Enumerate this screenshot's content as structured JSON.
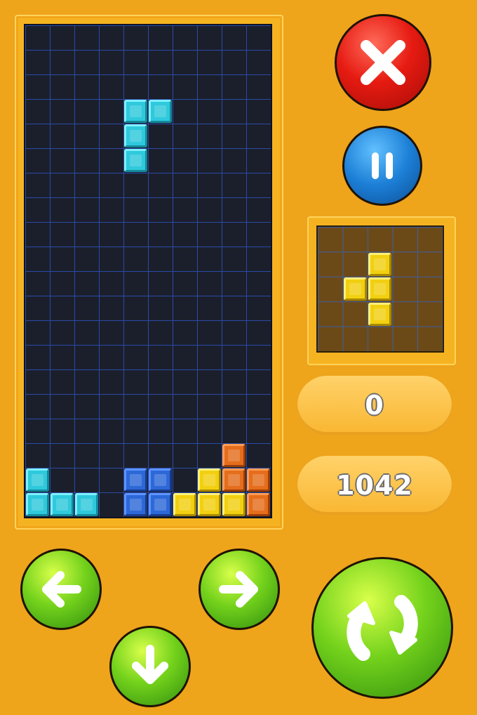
{
  "board": {
    "cols": 10,
    "rows": 20,
    "falling_piece": {
      "color": "cyan",
      "cells": [
        [
          4,
          3
        ],
        [
          5,
          3
        ],
        [
          4,
          4
        ],
        [
          4,
          5
        ]
      ]
    },
    "settled_cells": [
      {
        "c": 0,
        "r": 18,
        "color": "cyan"
      },
      {
        "c": 0,
        "r": 19,
        "color": "cyan"
      },
      {
        "c": 1,
        "r": 19,
        "color": "cyan"
      },
      {
        "c": 2,
        "r": 19,
        "color": "cyan"
      },
      {
        "c": 4,
        "r": 18,
        "color": "blue"
      },
      {
        "c": 5,
        "r": 18,
        "color": "blue"
      },
      {
        "c": 4,
        "r": 19,
        "color": "blue"
      },
      {
        "c": 5,
        "r": 19,
        "color": "blue"
      },
      {
        "c": 6,
        "r": 19,
        "color": "yellow"
      },
      {
        "c": 7,
        "r": 18,
        "color": "yellow"
      },
      {
        "c": 7,
        "r": 19,
        "color": "yellow"
      },
      {
        "c": 8,
        "r": 19,
        "color": "yellow"
      },
      {
        "c": 8,
        "r": 17,
        "color": "orange"
      },
      {
        "c": 8,
        "r": 18,
        "color": "orange"
      },
      {
        "c": 9,
        "r": 18,
        "color": "orange"
      },
      {
        "c": 9,
        "r": 19,
        "color": "orange"
      }
    ]
  },
  "next_piece": {
    "color": "yellow",
    "cells": [
      [
        2,
        1
      ],
      [
        1,
        2
      ],
      [
        2,
        2
      ],
      [
        2,
        3
      ]
    ]
  },
  "stats": {
    "lines": "0",
    "score": "1042"
  },
  "buttons": {
    "close_icon": "close-icon",
    "pause_icon": "pause-icon",
    "left_icon": "arrow-left-icon",
    "right_icon": "arrow-right-icon",
    "down_icon": "arrow-down-icon",
    "rotate_icon": "rotate-icon"
  },
  "colors": {
    "background": "#eea41b",
    "board": "#1b1f2b",
    "grid": "#2b4aa8",
    "close_button": "#e61b12",
    "pause_button": "#1c7fd6",
    "control_buttons": "#74d21c"
  }
}
